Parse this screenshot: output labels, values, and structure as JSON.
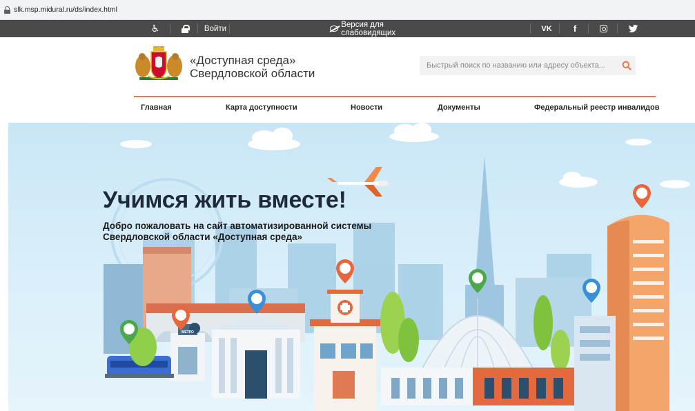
{
  "browser": {
    "url": "slk.msp.midural.ru/ds/index.html"
  },
  "topbar": {
    "login_label": "Войти",
    "low_vision_label": "Версия для слабовидящих",
    "vk_label": "VK",
    "fb_label": "f",
    "icons": [
      "accessibility-icon",
      "lock-icon",
      "eye-crossed-icon",
      "vk-icon",
      "facebook-icon",
      "instagram-icon",
      "twitter-icon"
    ]
  },
  "header": {
    "title_line1": "«Доступная среда»",
    "title_line2": "Свердловской области",
    "search_placeholder": "Быстрый поиск по названию или адресу объекта..."
  },
  "nav": {
    "items": [
      {
        "label": "Главная"
      },
      {
        "label": "Карта доступности"
      },
      {
        "label": "Новости"
      },
      {
        "label": "Документы"
      },
      {
        "label": "Федеральный реестр инвалидов"
      }
    ]
  },
  "hero": {
    "title": "Учимся жить вместе!",
    "subtitle_line1": "Добро пожаловать на сайт автоматизированной системы",
    "subtitle_line2": "Свердловской области «Доступная среда»",
    "metro_label": "МЕТРО"
  },
  "colors": {
    "topbar": "#4a4a4a",
    "accent": "#e07a52",
    "hero_sky": "#c9e6f6",
    "pin_orange": "#e8663c",
    "pin_blue": "#3a8fd9",
    "pin_green": "#4aa84a"
  }
}
